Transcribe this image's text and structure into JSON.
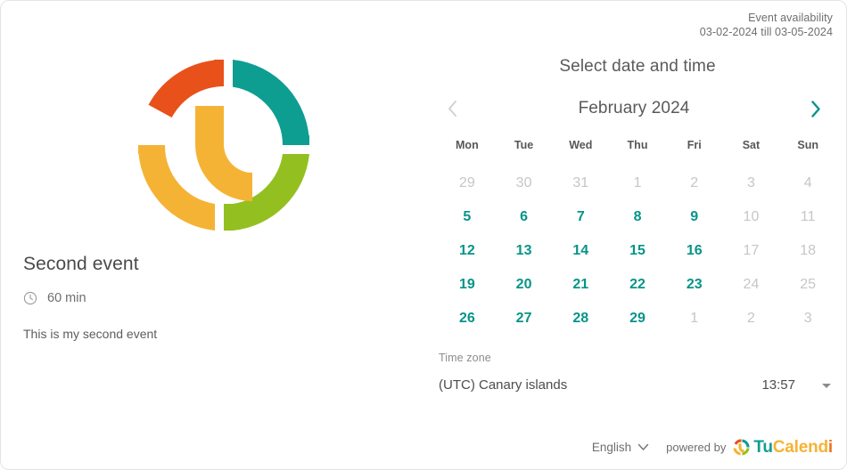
{
  "availability": {
    "title": "Event availability",
    "range": "03-02-2024 till 03-05-2024"
  },
  "logo": {
    "name": "tucalendi-clock-logo",
    "colors": {
      "red": "#e8511a",
      "teal": "#0e9e91",
      "green": "#93c020",
      "yellow": "#f5b335"
    }
  },
  "event": {
    "title": "Second event",
    "duration_icon": "clock-icon",
    "duration": "60 min",
    "description": "This is my second event"
  },
  "scheduler": {
    "title": "Select date and time",
    "prev_icon": "chevron-left-icon",
    "next_icon": "chevron-right-icon",
    "month": "February 2024",
    "weekdays": [
      "Mon",
      "Tue",
      "Wed",
      "Thu",
      "Fri",
      "Sat",
      "Sun"
    ],
    "weeks": [
      [
        {
          "label": "29",
          "state": "muted"
        },
        {
          "label": "30",
          "state": "muted"
        },
        {
          "label": "31",
          "state": "muted"
        },
        {
          "label": "1",
          "state": "muted"
        },
        {
          "label": "2",
          "state": "muted"
        },
        {
          "label": "3",
          "state": "muted"
        },
        {
          "label": "4",
          "state": "muted"
        }
      ],
      [
        {
          "label": "5",
          "state": "active"
        },
        {
          "label": "6",
          "state": "active"
        },
        {
          "label": "7",
          "state": "active"
        },
        {
          "label": "8",
          "state": "active"
        },
        {
          "label": "9",
          "state": "active"
        },
        {
          "label": "10",
          "state": "muted"
        },
        {
          "label": "11",
          "state": "muted"
        }
      ],
      [
        {
          "label": "12",
          "state": "active"
        },
        {
          "label": "13",
          "state": "active"
        },
        {
          "label": "14",
          "state": "active"
        },
        {
          "label": "15",
          "state": "active"
        },
        {
          "label": "16",
          "state": "active"
        },
        {
          "label": "17",
          "state": "muted"
        },
        {
          "label": "18",
          "state": "muted"
        }
      ],
      [
        {
          "label": "19",
          "state": "active"
        },
        {
          "label": "20",
          "state": "active"
        },
        {
          "label": "21",
          "state": "active"
        },
        {
          "label": "22",
          "state": "active"
        },
        {
          "label": "23",
          "state": "active"
        },
        {
          "label": "24",
          "state": "muted"
        },
        {
          "label": "25",
          "state": "muted"
        }
      ],
      [
        {
          "label": "26",
          "state": "active"
        },
        {
          "label": "27",
          "state": "active"
        },
        {
          "label": "28",
          "state": "active"
        },
        {
          "label": "29",
          "state": "active"
        },
        {
          "label": "1",
          "state": "muted"
        },
        {
          "label": "2",
          "state": "muted"
        },
        {
          "label": "3",
          "state": "muted"
        }
      ]
    ],
    "accent_color": "#079488",
    "muted_color": "#c6c6c6"
  },
  "timezone": {
    "label": "Time zone",
    "value": "(UTC) Canary islands",
    "time": "13:57",
    "caret_icon": "caret-down-icon"
  },
  "footer": {
    "language": "English",
    "language_caret_icon": "chevron-down-icon",
    "powered_by": "powered by",
    "brand_mark_icon": "tucalendi-mark-icon",
    "brand_part1": "Tu",
    "brand_part2": "Calend",
    "brand_part3": "i"
  }
}
